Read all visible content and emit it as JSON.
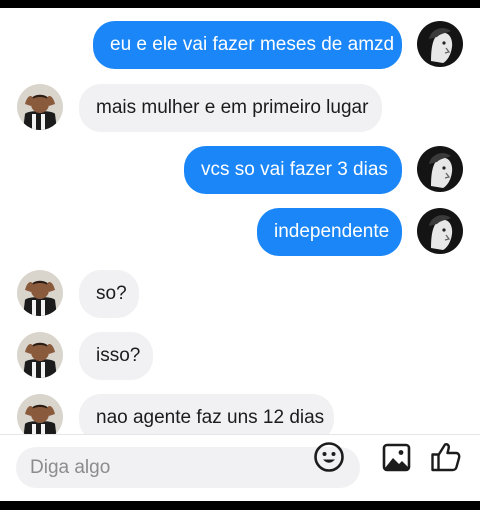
{
  "conversation": {
    "messages": [
      {
        "direction": "outgoing",
        "text": "eu e ele vai fazer meses de amzd"
      },
      {
        "direction": "incoming",
        "text": "mais mulher e em primeiro lugar"
      },
      {
        "direction": "outgoing",
        "text": "vcs so vai fazer 3 dias"
      },
      {
        "direction": "outgoing",
        "text": "independente"
      },
      {
        "direction": "incoming",
        "text": "so?"
      },
      {
        "direction": "incoming",
        "text": "isso?"
      },
      {
        "direction": "incoming",
        "text": "nao agente faz uns 12 dias"
      }
    ]
  },
  "composer": {
    "placeholder": "Diga algo"
  },
  "icons": {
    "emoji": "emoji-icon",
    "image": "image-icon",
    "like": "thumbs-up-icon"
  },
  "colors": {
    "outgoing_bubble": "#1a86f7",
    "incoming_bubble": "#f1f1f3",
    "icon": "#1c1c1c"
  }
}
